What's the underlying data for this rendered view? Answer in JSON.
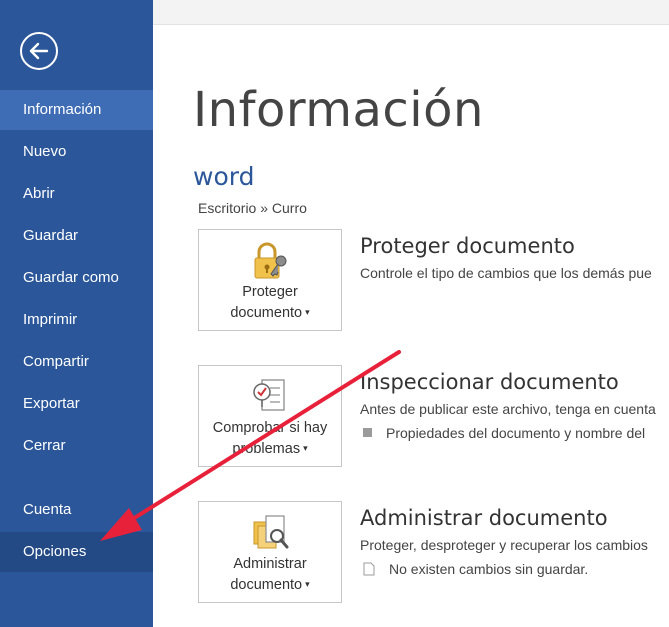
{
  "sidebar": {
    "back_label": "Volver",
    "items": [
      {
        "label": "Información"
      },
      {
        "label": "Nuevo"
      },
      {
        "label": "Abrir"
      },
      {
        "label": "Guardar"
      },
      {
        "label": "Guardar como"
      },
      {
        "label": "Imprimir"
      },
      {
        "label": "Compartir"
      },
      {
        "label": "Exportar"
      },
      {
        "label": "Cerrar"
      },
      {
        "label": "Cuenta"
      },
      {
        "label": "Opciones"
      }
    ],
    "active_item": "Información",
    "highlighted_item": "Opciones"
  },
  "main": {
    "title": "Información",
    "document_name": "word",
    "document_path": "Escritorio » Curro",
    "sections": [
      {
        "button_line1": "Proteger",
        "button_line2": "documento",
        "icon": "lock-key-icon",
        "title": "Proteger documento",
        "description": "Controle el tipo de cambios que los demás pue",
        "bullet": ""
      },
      {
        "button_line1": "Comprobar si hay",
        "button_line2": "problemas",
        "icon": "checklist-inspect-icon",
        "title": "Inspeccionar documento",
        "description": "Antes de publicar este archivo, tenga en cuenta",
        "bullet": "Propiedades del documento y nombre del"
      },
      {
        "button_line1": "Administrar",
        "button_line2": "documento",
        "icon": "manage-versions-icon",
        "title": "Administrar documento",
        "description": "Proteger, desproteger y recuperar los cambios",
        "bullet": "No existen cambios sin guardar."
      }
    ]
  },
  "colors": {
    "sidebar_bg": "#2b579a",
    "sidebar_active": "#3e6db5",
    "accent_text": "#2b579a",
    "annotation_arrow": "#e8213a"
  }
}
